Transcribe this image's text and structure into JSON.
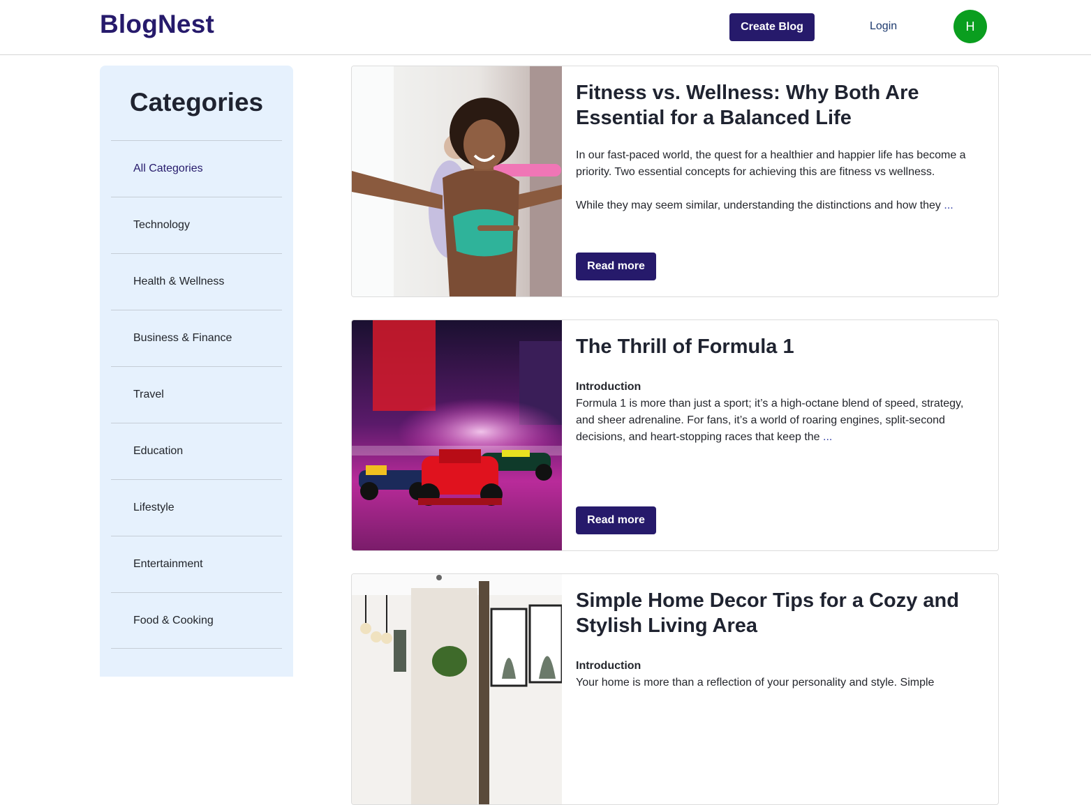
{
  "header": {
    "logo": "BlogNest",
    "create_label": "Create Blog",
    "login_label": "Login",
    "avatar_initial": "H",
    "avatar_color": "#0a9e1f",
    "brand_color": "#261a6b"
  },
  "sidebar": {
    "title": "Categories",
    "items": [
      {
        "label": "All Categories",
        "active": true
      },
      {
        "label": "Technology"
      },
      {
        "label": "Health & Wellness"
      },
      {
        "label": "Business & Finance"
      },
      {
        "label": "Travel"
      },
      {
        "label": "Education"
      },
      {
        "label": "Lifestyle"
      },
      {
        "label": "Entertainment"
      },
      {
        "label": "Food & Cooking"
      }
    ]
  },
  "posts": [
    {
      "title": "Fitness vs. Wellness: Why Both Are Essential for a Balanced Life",
      "paragraph1": "In our fast-paced world, the quest for a healthier and happier life has become a priority. Two essential concepts for achieving this are fitness vs wellness.",
      "paragraph2": "While they may seem similar, understanding the distinctions and how they",
      "ellipsis": "...",
      "read_more": "Read more",
      "image": "woman-exercising-photo"
    },
    {
      "title": "The Thrill of Formula 1",
      "heading": "Introduction",
      "paragraph1": "Formula 1 is more than just a sport; it’s a high-octane blend of speed, strategy, and sheer adrenaline. For fans, it’s a world of roaring engines, split-second decisions, and heart-stopping races that keep the",
      "ellipsis": "...",
      "read_more": "Read more",
      "image": "formula-1-cars-photo"
    },
    {
      "title": "Simple Home Decor Tips for a Cozy and Stylish Living Area",
      "heading": "Introduction",
      "paragraph1": "Your home is more than a reflection of your personality and style. Simple",
      "image": "living-room-photo"
    }
  ]
}
